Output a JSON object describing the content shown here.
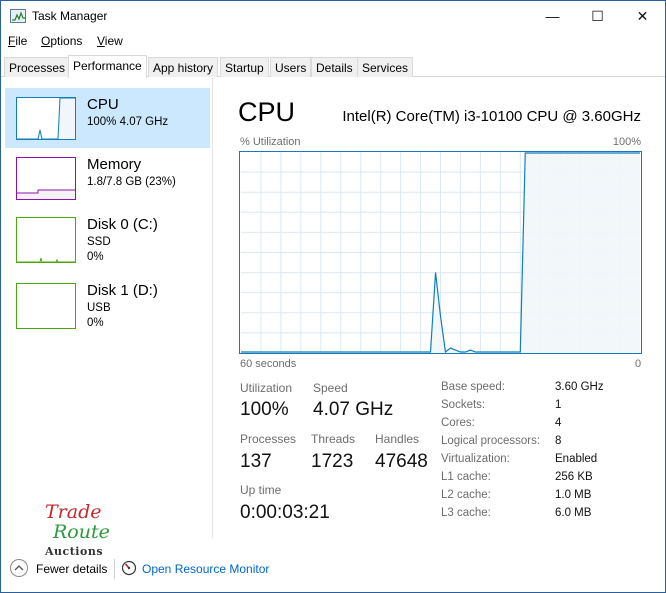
{
  "window": {
    "title": "Task Manager",
    "controls": {
      "minimize": "—",
      "maximize": "☐",
      "close": "✕"
    }
  },
  "menu": [
    {
      "label": "File",
      "accel": "F",
      "rest": "ile"
    },
    {
      "label": "Options",
      "accel": "O",
      "rest": "ptions"
    },
    {
      "label": "View",
      "accel": "V",
      "rest": "iew"
    }
  ],
  "tabs": [
    "Processes",
    "Performance",
    "App history",
    "Startup",
    "Users",
    "Details",
    "Services"
  ],
  "active_tab": "Performance",
  "resources": [
    {
      "name": "CPU",
      "sub1": "100%  4.07 GHz",
      "sub2": "",
      "color": "#117dbb",
      "fill": "#f1f6fa"
    },
    {
      "name": "Memory",
      "sub1": "1.8/7.8 GB (23%)",
      "sub2": "",
      "color": "#8b12ae",
      "fill": "#f4f2f4"
    },
    {
      "name": "Disk 0 (C:)",
      "sub1": "SSD",
      "sub2": "0%",
      "color": "#4da60c",
      "fill": "#eff4ec"
    },
    {
      "name": "Disk 1 (D:)",
      "sub1": "USB",
      "sub2": "0%",
      "color": "#4da60c",
      "fill": "#eff4ec"
    }
  ],
  "detail": {
    "title": "CPU",
    "model": "Intel(R) Core(TM) i3-10100 CPU @ 3.60GHz",
    "graph_label": "% Utilization",
    "graph_max": "100%",
    "time_span": "60 seconds",
    "graph_min": "0",
    "graph_color": "#117dbb",
    "utilization_history": [
      0,
      0,
      0,
      0,
      0,
      0,
      0,
      0,
      0,
      0,
      0,
      0,
      0,
      0,
      0,
      0,
      0,
      0,
      0,
      0,
      0,
      0,
      0,
      0,
      0,
      0,
      0,
      0,
      0,
      0,
      0,
      0,
      0,
      0,
      0,
      0,
      0,
      0,
      0,
      40,
      18,
      0,
      2,
      1,
      0,
      0,
      1,
      0,
      0,
      0,
      0,
      0,
      0,
      0,
      0,
      0,
      0,
      100,
      100,
      100,
      100,
      100,
      100,
      100,
      100,
      100,
      100,
      100,
      100,
      100,
      100,
      100,
      100,
      100,
      100,
      100,
      100,
      100,
      100,
      100,
      100
    ]
  },
  "stats": {
    "utilization_label": "Utilization",
    "utilization": "100%",
    "speed_label": "Speed",
    "speed": "4.07 GHz",
    "processes_label": "Processes",
    "processes": "137",
    "threads_label": "Threads",
    "threads": "1723",
    "handles_label": "Handles",
    "handles": "47648",
    "uptime_label": "Up time",
    "uptime": "0:00:03:21"
  },
  "specs": [
    {
      "k": "Base speed:",
      "v": "3.60 GHz"
    },
    {
      "k": "Sockets:",
      "v": "1"
    },
    {
      "k": "Cores:",
      "v": "4"
    },
    {
      "k": "Logical processors:",
      "v": "8"
    },
    {
      "k": "Virtualization:",
      "v": "Enabled"
    },
    {
      "k": "L1 cache:",
      "v": "256 KB"
    },
    {
      "k": "L2 cache:",
      "v": "1.0 MB"
    },
    {
      "k": "L3 cache:",
      "v": "6.0 MB"
    }
  ],
  "footer": {
    "fewer_details": "Fewer details",
    "open_resource_monitor": "Open Resource Monitor"
  },
  "watermark": {
    "line1": "Trade",
    "line2": "Route",
    "line3": "Auctions"
  }
}
